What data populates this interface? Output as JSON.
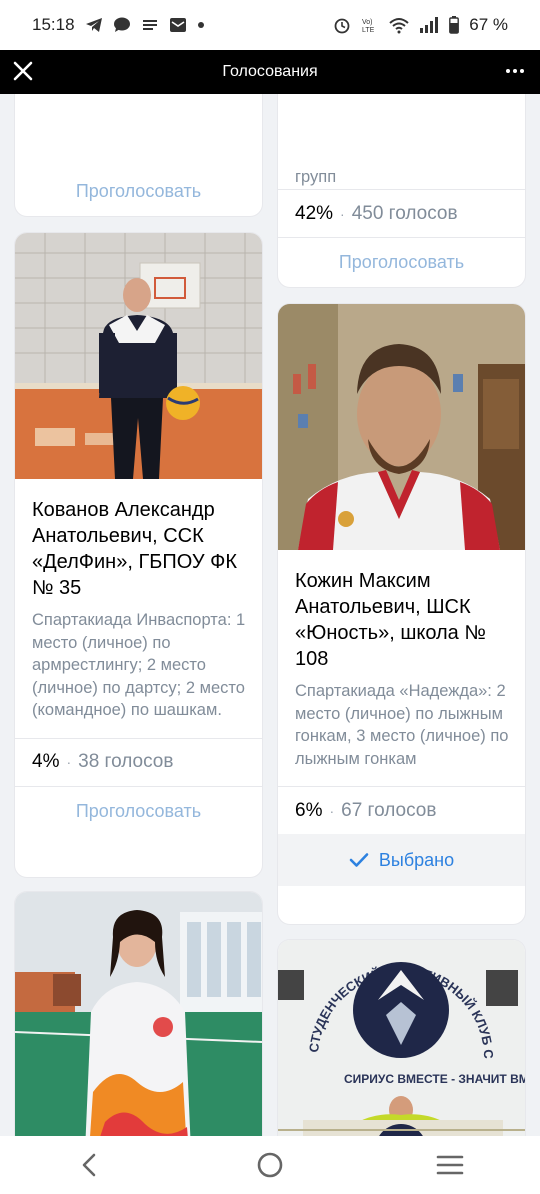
{
  "status_bar": {
    "time": "15:18",
    "battery": "67 %"
  },
  "header": {
    "title": "Голосования"
  },
  "cards": {
    "top_left": {
      "vote_label": "Проголосовать"
    },
    "top_right": {
      "partial_text": "групп",
      "percent": "42%",
      "votes": "450 голосов",
      "vote_label": "Проголосовать"
    },
    "kovanov": {
      "name": "Кованов Александр Анатольевич, ССК «ДелФин», ГБПОУ ФК № 35",
      "description": "Спартакиада Инваспорта: 1 место (личное) по армрестлингу; 2 место (личное) по дартсу; 2 место (командное) по шашкам.",
      "percent": "4%",
      "votes": "38 голосов",
      "vote_label": "Проголосовать"
    },
    "kozhin": {
      "name": "Кожин Максим Анатольевич, ШСК «Юность», школа № 108",
      "description": "Спартакиада «Надежда»: 2 место (личное) по лыжным гонкам, 3 место (личное) по лыжным гонкам",
      "percent": "6%",
      "votes": "67 голосов",
      "chosen_label": "Выбрано"
    },
    "bottom_right_photo": {
      "banner_text": "СТУДЕНЧЕСКИЙ СПОРТИВНЫЙ КЛУБ СИРИУС",
      "slogan": "СИРИУС ВМЕСТЕ - ЗНАЧИТ ВМЕСТЕ"
    }
  },
  "separator": "·",
  "colors": {
    "accent": "#2d81e0",
    "vote_inactive": "#94b7dc",
    "secondary_text": "#818c99"
  }
}
